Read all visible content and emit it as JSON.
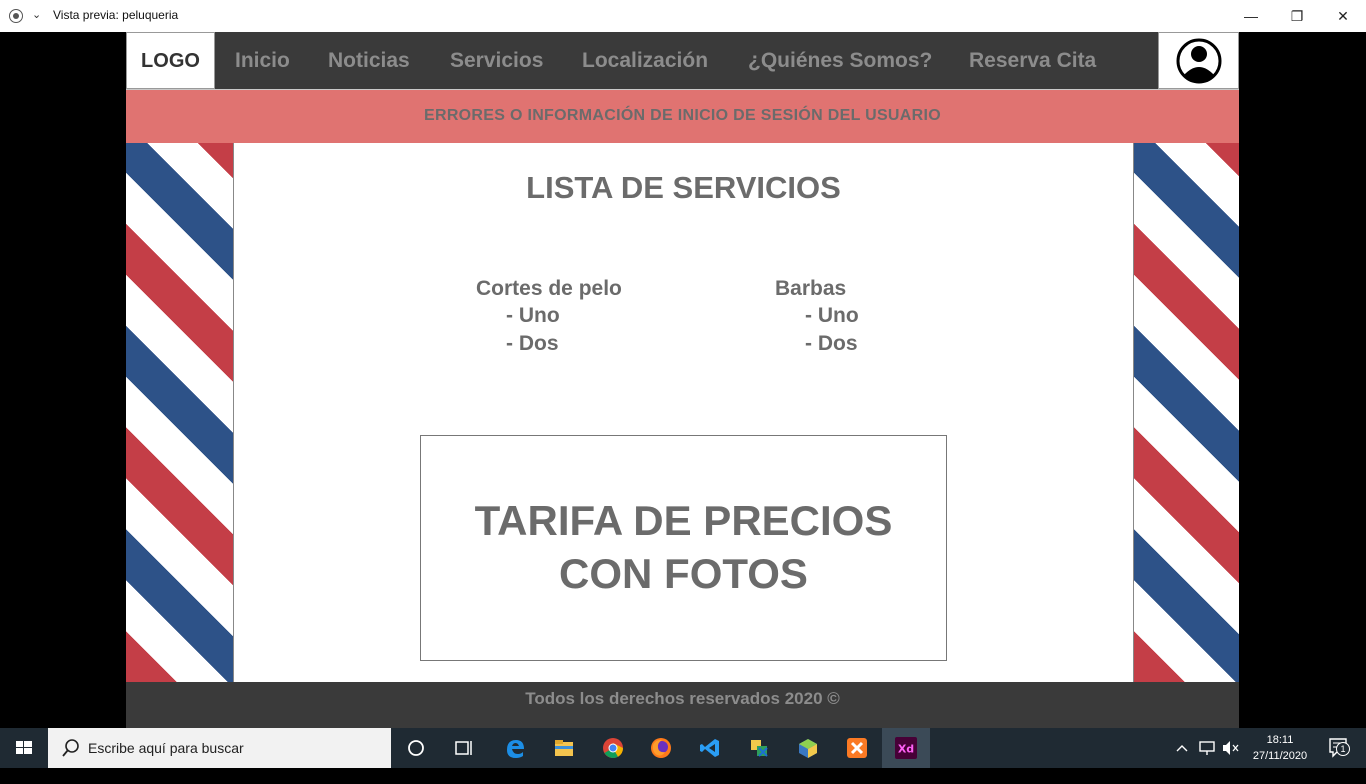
{
  "window": {
    "title": "Vista previa: peluqueria",
    "minimize_glyph": "—",
    "maximize_glyph": "❐",
    "close_glyph": "✕",
    "dropdown_glyph": "⌄"
  },
  "nav": {
    "logo": "LOGO",
    "items": [
      "Inicio",
      "Noticias",
      "Servicios",
      "Localización",
      "¿Quiénes Somos?",
      "Reserva Cita"
    ]
  },
  "banner": {
    "text": "ERRORES O INFORMACIÓN DE INICIO DE SESIÓN DEL USUARIO"
  },
  "services": {
    "title": "LISTA DE SERVICIOS",
    "columns": [
      {
        "heading": "Cortes de pelo",
        "items": [
          "- Uno",
          "- Dos"
        ]
      },
      {
        "heading": "Barbas",
        "items": [
          "- Uno",
          "- Dos"
        ]
      }
    ]
  },
  "prices": {
    "line1": "TARIFA DE PRECIOS",
    "line2": "CON FOTOS"
  },
  "footer": {
    "text": "Todos los derechos reservados 2020 ©"
  },
  "taskbar": {
    "search_placeholder": "Escribe aquí para buscar",
    "time": "18:11",
    "date": "27/11/2020",
    "notification_count": "1"
  },
  "colors": {
    "nav_bg": "#3a3a3a",
    "banner_bg": "#e07371",
    "stripe_red": "#c43e47",
    "stripe_blue": "#2d5288",
    "text_gray": "#6b6b6b",
    "taskbar_bg": "#1f2a33"
  }
}
